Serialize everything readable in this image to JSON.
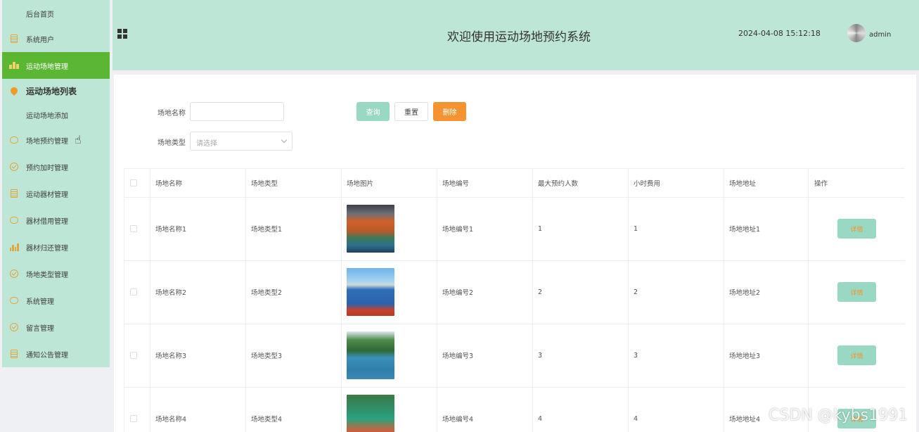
{
  "sidebar": {
    "items": [
      {
        "label": "后台首页",
        "icon": "none",
        "state": "normal"
      },
      {
        "label": "系统用户",
        "icon": "document-icon",
        "state": "normal"
      },
      {
        "label": "运动场地管理",
        "icon": "chart-icon",
        "state": "active"
      },
      {
        "label": "运动场地列表",
        "icon": "location-pin-icon",
        "state": "current"
      },
      {
        "label": "运动场地添加",
        "icon": "none",
        "state": "sub"
      },
      {
        "label": "场地预约管理",
        "icon": "chat-bubble-icon",
        "state": "normal"
      },
      {
        "label": "预约加时管理",
        "icon": "check-circle-icon",
        "state": "normal"
      },
      {
        "label": "运动器材管理",
        "icon": "document-icon",
        "state": "normal"
      },
      {
        "label": "器材借用管理",
        "icon": "chat-bubble-icon",
        "state": "normal"
      },
      {
        "label": "器材归还管理",
        "icon": "bar-chart-icon",
        "state": "normal"
      },
      {
        "label": "场地类型管理",
        "icon": "check-circle-icon",
        "state": "normal"
      },
      {
        "label": "系统管理",
        "icon": "chat-bubble-icon",
        "state": "normal"
      },
      {
        "label": "留言管理",
        "icon": "check-circle-icon",
        "state": "normal"
      },
      {
        "label": "通知公告管理",
        "icon": "document-icon",
        "state": "normal"
      }
    ]
  },
  "header": {
    "title": "欢迎使用运动场地预约系统",
    "datetime": "2024-04-08 15:12:18",
    "user": "admin"
  },
  "search": {
    "name_label": "场地名称",
    "name_value": "",
    "type_label": "场地类型",
    "type_placeholder": "请选择",
    "query_label": "查询",
    "reset_label": "重置",
    "delete_label": "删除"
  },
  "table": {
    "headers": [
      "场地名称",
      "场地类型",
      "场地图片",
      "场地编号",
      "最大预约人数",
      "小时费用",
      "场地地址",
      "操作"
    ],
    "detail_label": "详情",
    "rows": [
      {
        "name": "场地名称1",
        "type": "场地类型1",
        "code": "场地编号1",
        "max": "1",
        "fee": "1",
        "addr": "场地地址1"
      },
      {
        "name": "场地名称2",
        "type": "场地类型2",
        "code": "场地编号2",
        "max": "2",
        "fee": "2",
        "addr": "场地地址2"
      },
      {
        "name": "场地名称3",
        "type": "场地类型3",
        "code": "场地编号3",
        "max": "3",
        "fee": "3",
        "addr": "场地地址3"
      },
      {
        "name": "场地名称4",
        "type": "场地类型4",
        "code": "场地编号4",
        "max": "4",
        "fee": "4",
        "addr": "场地地址4"
      }
    ]
  },
  "watermark": "CSDN @kybs1991",
  "colors": {
    "sidebar_bg": "#bde6d6",
    "active_bg": "#5bb634",
    "accent_orange": "#f59331",
    "detail_btn": "#99d8c2"
  }
}
